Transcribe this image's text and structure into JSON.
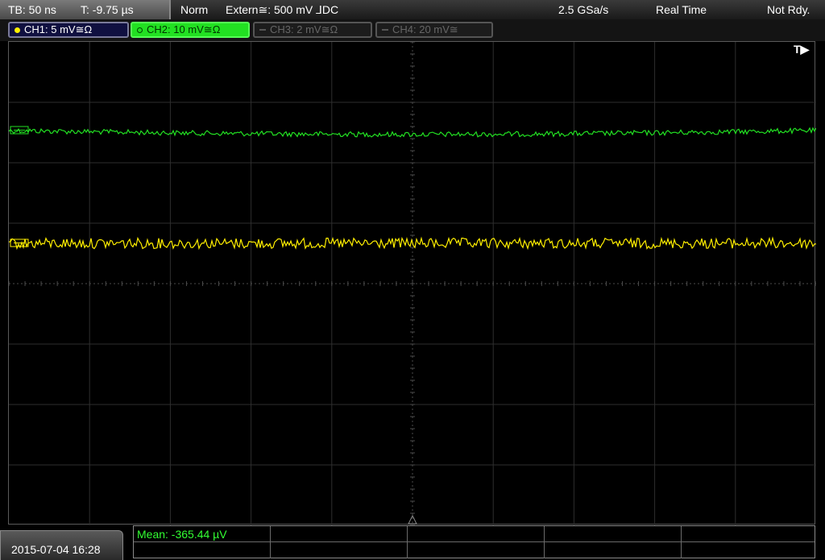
{
  "topbar": {
    "timebase": "TB: 50 ns",
    "trigger_time": "T: -9.75 µs",
    "trigger_mode": "Norm",
    "trigger_source": "Extern≅: 500 mV ⅃DC",
    "sample_rate": "2.5 GSa/s",
    "acq_mode": "Real Time",
    "status": "Not Rdy."
  },
  "channels": [
    {
      "label": "CH1: 5 mV≅Ω",
      "color": "#ffef00",
      "active": true
    },
    {
      "label": "CH2: 10 mV≅Ω",
      "color": "#22e022",
      "active": true
    },
    {
      "label": "CH3: 2 mV≅Ω",
      "color": "#555555",
      "active": false
    },
    {
      "label": "CH4: 20 mV≅",
      "color": "#555555",
      "active": false
    }
  ],
  "trigger_marker": "T▶",
  "bottom": {
    "datetime": "2015-07-04 16:28",
    "measurement": "Mean: -365.44 µV"
  },
  "colors": {
    "ch1": "#ffef00",
    "ch2": "#22e022",
    "grid": "#5a5a5a"
  }
}
